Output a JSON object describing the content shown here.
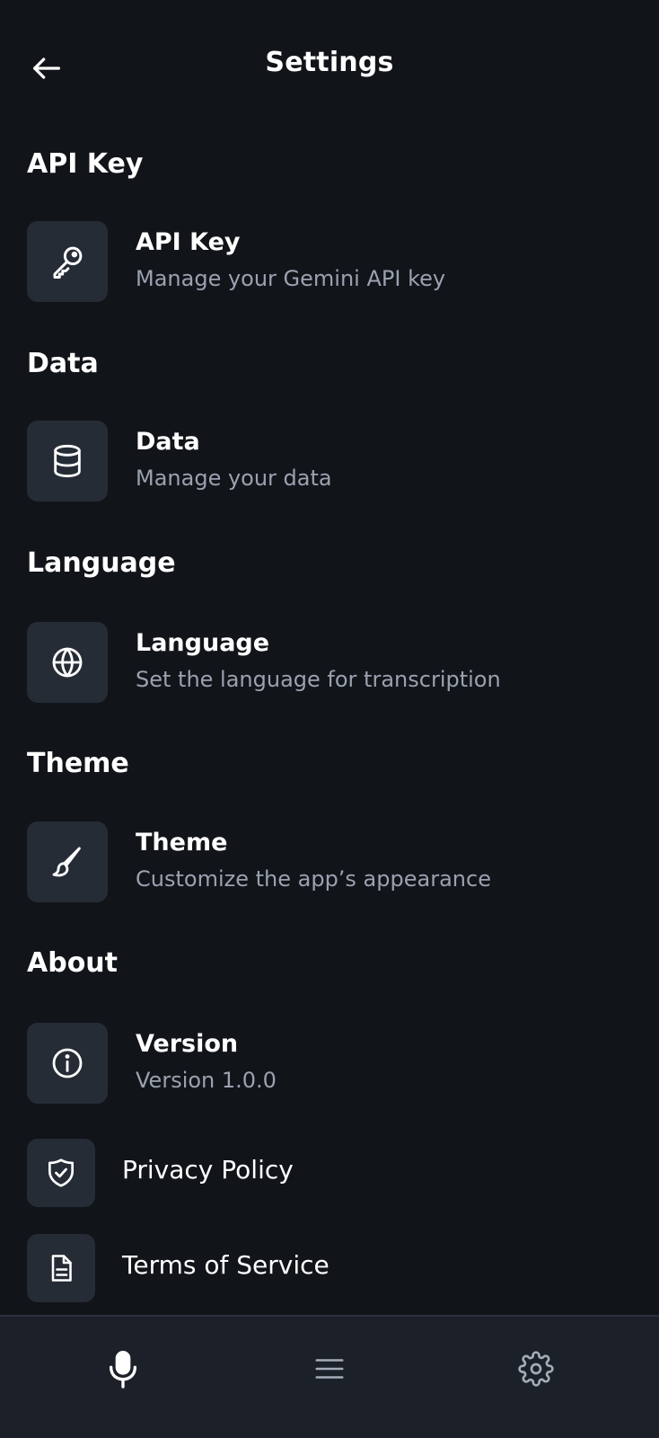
{
  "header": {
    "title": "Settings"
  },
  "sections": [
    {
      "title": "API Key",
      "item": {
        "title": "API Key",
        "subtitle": "Manage your Gemini API key",
        "icon": "key-icon"
      }
    },
    {
      "title": "Data",
      "item": {
        "title": "Data",
        "subtitle": "Manage your data",
        "icon": "database-icon"
      }
    },
    {
      "title": "Language",
      "item": {
        "title": "Language",
        "subtitle": "Set the language for transcription",
        "icon": "globe-icon"
      }
    },
    {
      "title": "Theme",
      "item": {
        "title": "Theme",
        "subtitle": "Customize the app’s appearance",
        "icon": "paintbrush-icon"
      }
    },
    {
      "title": "About",
      "item": {
        "title": "Version",
        "subtitle": "Version 1.0.0",
        "icon": "info-icon"
      }
    }
  ],
  "about_links": [
    {
      "label": "Privacy Policy",
      "icon": "shield-check-icon"
    },
    {
      "label": "Terms of Service",
      "icon": "document-icon"
    }
  ],
  "bottom_nav": [
    {
      "name": "record",
      "icon": "microphone-icon",
      "active": true
    },
    {
      "name": "history",
      "icon": "menu-icon",
      "active": false
    },
    {
      "name": "settings",
      "icon": "gear-icon",
      "active": false
    }
  ],
  "colors": {
    "background": "#111419",
    "icon_box": "#262c36",
    "subtitle": "#9aa2b0",
    "nav_background": "#1c2029"
  }
}
